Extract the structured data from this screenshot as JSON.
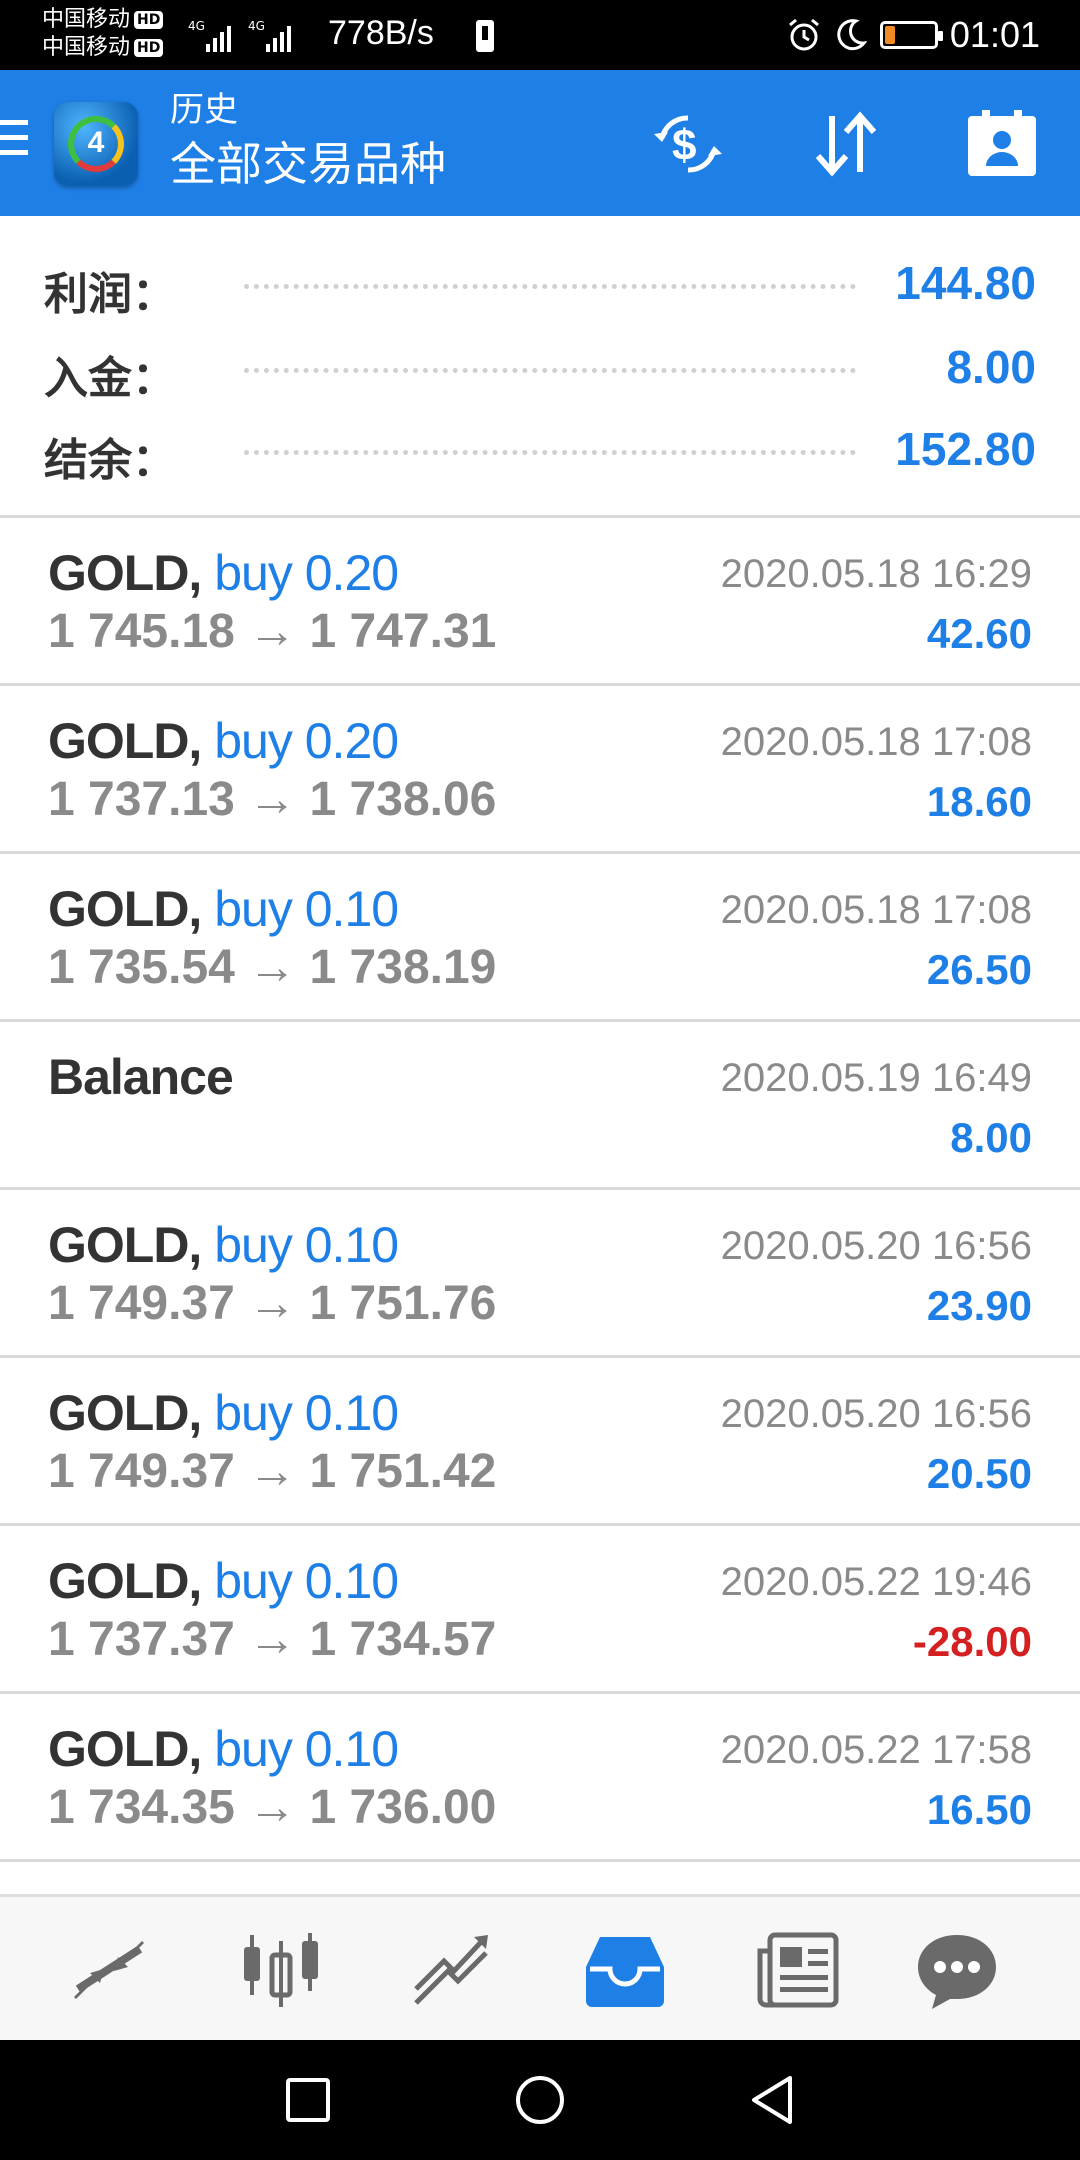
{
  "status_bar": {
    "carrier1": "中国移动",
    "carrier2": "中国移动",
    "hd_badge": "HD",
    "speed": "778B/s",
    "time": "01:01",
    "icons": [
      "signal-icon",
      "usb-icon",
      "alarm-icon",
      "moon-icon",
      "battery-icon"
    ]
  },
  "app_bar": {
    "subtitle": "历史",
    "title": "全部交易品种",
    "app_logo_number": "4",
    "icons": [
      "menu-icon",
      "currency-exchange-icon",
      "sort-icon",
      "contact-icon"
    ]
  },
  "summary": {
    "rows": [
      {
        "label": "利润：",
        "value": "144.80"
      },
      {
        "label": "入金：",
        "value": "8.00"
      },
      {
        "label": "结余：",
        "value": "152.80"
      }
    ]
  },
  "deals": [
    {
      "symbol": "GOLD,",
      "action": "buy 0.20",
      "prices": "1 745.18 → 1 747.31",
      "time": "2020.05.18 16:29",
      "profit": "42.60",
      "negative": false
    },
    {
      "symbol": "GOLD,",
      "action": "buy 0.20",
      "prices": "1 737.13 → 1 738.06",
      "time": "2020.05.18 17:08",
      "profit": "18.60",
      "negative": false
    },
    {
      "symbol": "GOLD,",
      "action": "buy 0.10",
      "prices": "1 735.54 → 1 738.19",
      "time": "2020.05.18 17:08",
      "profit": "26.50",
      "negative": false
    },
    {
      "symbol": "Balance",
      "action": "",
      "prices": "",
      "time": "2020.05.19 16:49",
      "profit": "8.00",
      "negative": false
    },
    {
      "symbol": "GOLD,",
      "action": "buy 0.10",
      "prices": "1 749.37 → 1 751.76",
      "time": "2020.05.20 16:56",
      "profit": "23.90",
      "negative": false
    },
    {
      "symbol": "GOLD,",
      "action": "buy 0.10",
      "prices": "1 749.37 → 1 751.42",
      "time": "2020.05.20 16:56",
      "profit": "20.50",
      "negative": false
    },
    {
      "symbol": "GOLD,",
      "action": "buy 0.10",
      "prices": "1 737.37 → 1 734.57",
      "time": "2020.05.22 19:46",
      "profit": "-28.00",
      "negative": true
    },
    {
      "symbol": "GOLD,",
      "action": "buy 0.10",
      "prices": "1 734.35 → 1 736.00",
      "time": "2020.05.22 17:58",
      "profit": "16.50",
      "negative": false
    }
  ],
  "bottom_nav": {
    "items": [
      "quotes-icon",
      "chart-icon",
      "trade-icon",
      "history-icon",
      "news-icon",
      "chat-icon"
    ],
    "active": "history-icon"
  },
  "system_nav": [
    "recents-square-icon",
    "home-circle-icon",
    "back-triangle-icon"
  ],
  "colors": {
    "accent": "#1e7fe6",
    "negative": "#d42020",
    "text_dark": "#333333",
    "text_muted": "#8a8a8a"
  }
}
